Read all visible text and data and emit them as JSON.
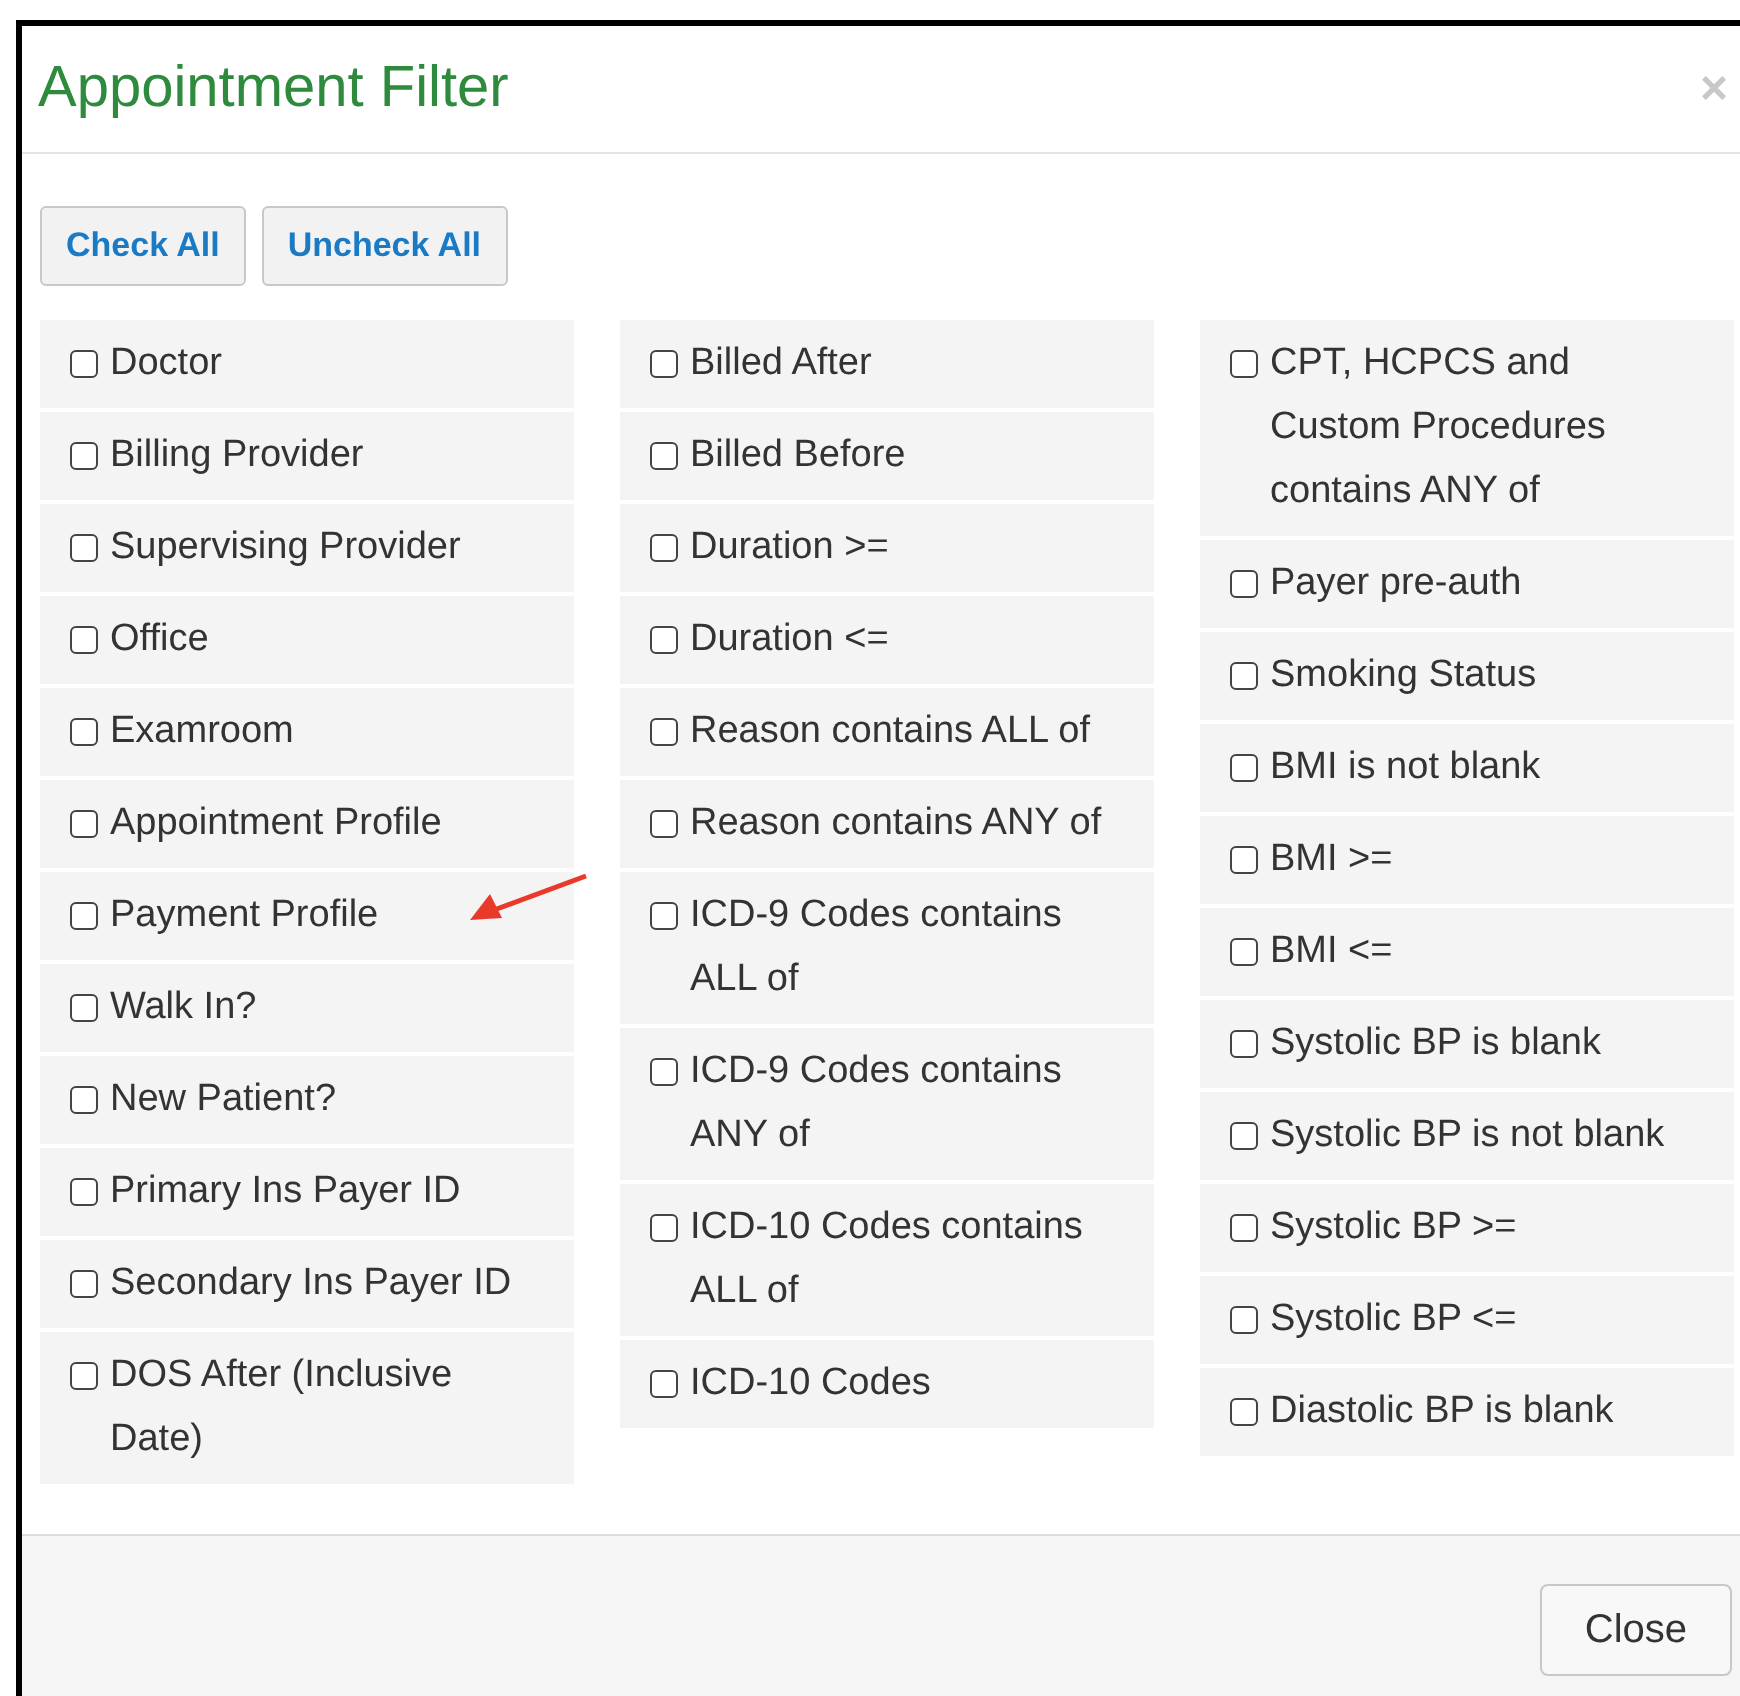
{
  "dialog": {
    "title": "Appointment Filter",
    "close_icon": "×"
  },
  "buttons": [
    "Check All",
    "Uncheck All"
  ],
  "columns": [
    [
      {
        "label": "Doctor",
        "checked": false
      },
      {
        "label": "Billing Provider",
        "checked": false
      },
      {
        "label": "Supervising Provider",
        "checked": false
      },
      {
        "label": "Office",
        "checked": false
      },
      {
        "label": "Examroom",
        "checked": false
      },
      {
        "label": "Appointment Profile",
        "checked": false
      },
      {
        "label": "Payment Profile",
        "checked": false
      },
      {
        "label": "Walk In?",
        "checked": false
      },
      {
        "label": "New Patient?",
        "checked": false
      },
      {
        "label": "Primary Ins Payer ID",
        "checked": false
      },
      {
        "label": "Secondary Ins Payer ID",
        "checked": false
      },
      {
        "label": "DOS After (Inclusive Date)",
        "checked": false
      }
    ],
    [
      {
        "label": "Billed After",
        "checked": false
      },
      {
        "label": "Billed Before",
        "checked": false
      },
      {
        "label": "Duration >=",
        "checked": false
      },
      {
        "label": "Duration <=",
        "checked": false
      },
      {
        "label": "Reason contains ALL of",
        "checked": false
      },
      {
        "label": "Reason contains ANY of",
        "checked": false
      },
      {
        "label": "ICD-9 Codes contains ALL of",
        "checked": false
      },
      {
        "label": "ICD-9 Codes contains ANY of",
        "checked": false
      },
      {
        "label": "ICD-10 Codes contains ALL of",
        "checked": false
      },
      {
        "label": "ICD-10 Codes",
        "checked": false
      }
    ],
    [
      {
        "label": "CPT, HCPCS and Custom Procedures contains ANY of",
        "checked": false
      },
      {
        "label": "Payer pre-auth",
        "checked": false
      },
      {
        "label": "Smoking Status",
        "checked": false
      },
      {
        "label": "BMI is not blank",
        "checked": false
      },
      {
        "label": "BMI >=",
        "checked": false
      },
      {
        "label": "BMI <=",
        "checked": false
      },
      {
        "label": "Systolic BP is blank",
        "checked": false
      },
      {
        "label": "Systolic BP is not blank",
        "checked": false
      },
      {
        "label": "Systolic BP >=",
        "checked": false
      },
      {
        "label": "Systolic BP <=",
        "checked": false
      },
      {
        "label": "Diastolic BP is blank",
        "checked": false
      }
    ]
  ],
  "footer": {
    "close_button": "Close"
  }
}
